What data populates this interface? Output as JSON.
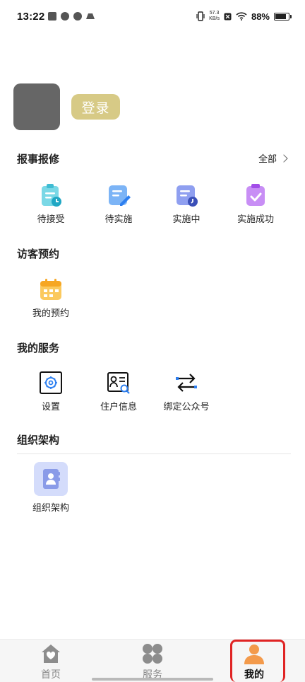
{
  "status_bar": {
    "time": "13:22",
    "net_speed_value": "57.3",
    "net_speed_unit": "KB/s",
    "battery_percent": "88%",
    "battery_level": 0.88
  },
  "profile": {
    "login_label": "登录"
  },
  "repair": {
    "title": "报事报修",
    "all_label": "全部",
    "items": [
      {
        "label": "待接受",
        "icon": "clipboard-pending-icon"
      },
      {
        "label": "待实施",
        "icon": "document-edit-icon"
      },
      {
        "label": "实施中",
        "icon": "document-progress-icon"
      },
      {
        "label": "实施成功",
        "icon": "clipboard-check-icon"
      }
    ]
  },
  "visitor": {
    "title": "访客预约",
    "items": [
      {
        "label": "我的预约",
        "icon": "calendar-icon"
      }
    ]
  },
  "services": {
    "title": "我的服务",
    "items": [
      {
        "label": "设置",
        "icon": "settings-gear-icon"
      },
      {
        "label": "住户信息",
        "icon": "resident-info-icon"
      },
      {
        "label": "绑定公众号",
        "icon": "bind-swap-icon"
      }
    ]
  },
  "org": {
    "title": "组织架构",
    "items": [
      {
        "label": "组织架构",
        "icon": "contact-book-icon"
      }
    ]
  },
  "tabs": [
    {
      "label": "首页",
      "icon": "home-icon",
      "active": false
    },
    {
      "label": "服务",
      "icon": "grid-clover-icon",
      "active": false
    },
    {
      "label": "我的",
      "icon": "person-icon",
      "active": true
    }
  ],
  "colors": {
    "login_button": "#d7ca86",
    "avatar": "#666666",
    "active_tab": "#f39a4b",
    "highlight": "#e02424"
  }
}
